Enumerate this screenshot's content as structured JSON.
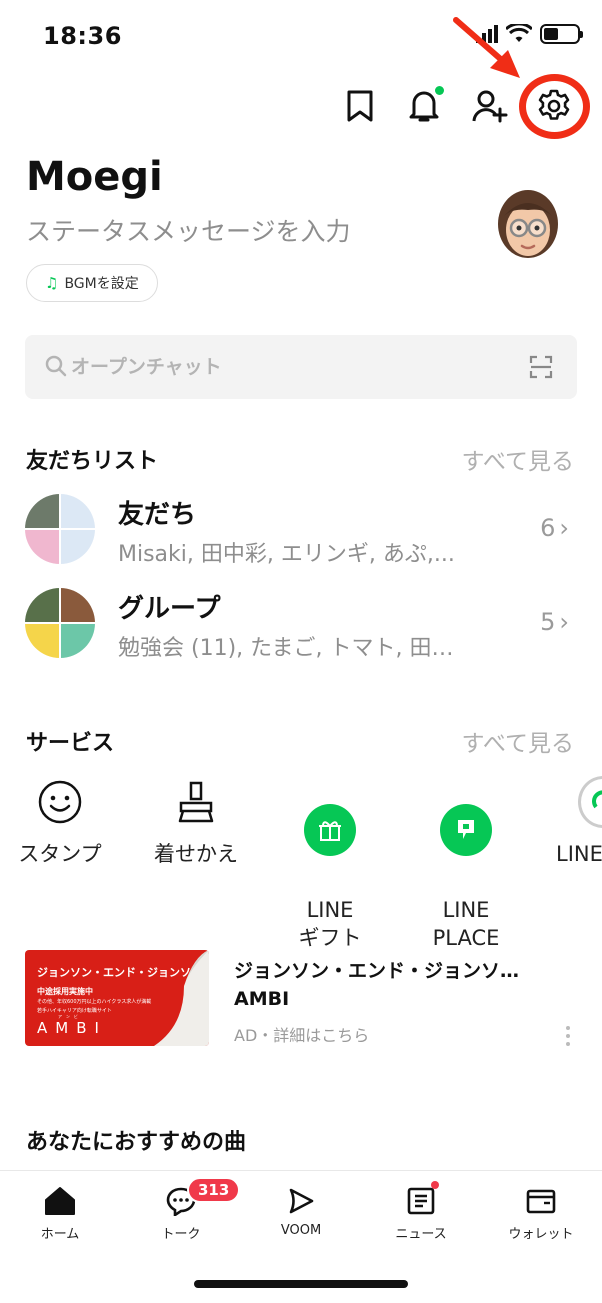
{
  "status_bar": {
    "time": "18:36"
  },
  "profile": {
    "name": "Moegi",
    "status_placeholder": "ステータスメッセージを入力",
    "bgm_label": "BGMを設定"
  },
  "search": {
    "placeholder": "オープンチャット"
  },
  "friends_section": {
    "title": "友だちリスト",
    "see_all": "すべて見る",
    "rows": [
      {
        "title": "友だち",
        "subtitle": "Misaki, 田中彩, エリンギ, あぷ,...",
        "count": "6"
      },
      {
        "title": "グループ",
        "subtitle": "勉強会 (11), たまご, トマト, 田…",
        "count": "5"
      }
    ]
  },
  "services_section": {
    "title": "サービス",
    "see_all": "すべて見る",
    "items": [
      {
        "label": "スタンプ",
        "icon": "smiley-icon"
      },
      {
        "label": "着せかえ",
        "icon": "brush-icon"
      },
      {
        "label": "LINE\nギフト",
        "icon": "gift-icon"
      },
      {
        "label": "LINE\nPLACE",
        "icon": "place-icon"
      },
      {
        "label": "LINE",
        "icon": "line-app-icon"
      }
    ]
  },
  "ad": {
    "image_headline": "ジョンソン・エンド・ジョンソン",
    "image_sub1": "中途採用実施中",
    "image_sub2": "その他、年収600万円以上のハイクラス求人が満載",
    "image_sub3": "若手ハイキャリア向け転職サイト",
    "image_brand": "AMBI",
    "image_ruby": "アンビ",
    "title": "ジョンソン・エンド・ジョンソ…",
    "brand": "AMBI",
    "meta": "AD・詳細はこちら"
  },
  "recommend_section": {
    "title": "あなたにおすすめの曲"
  },
  "bottom_nav": {
    "items": [
      {
        "label": "ホーム",
        "icon": "home-icon"
      },
      {
        "label": "トーク",
        "icon": "chat-icon",
        "badge": "313"
      },
      {
        "label": "VOOM",
        "icon": "voom-icon"
      },
      {
        "label": "ニュース",
        "icon": "news-icon"
      },
      {
        "label": "ウォレット",
        "icon": "wallet-icon"
      }
    ]
  },
  "colors": {
    "accent": "#06c755",
    "annotation": "#f02d16",
    "badge": "#f0394a"
  }
}
